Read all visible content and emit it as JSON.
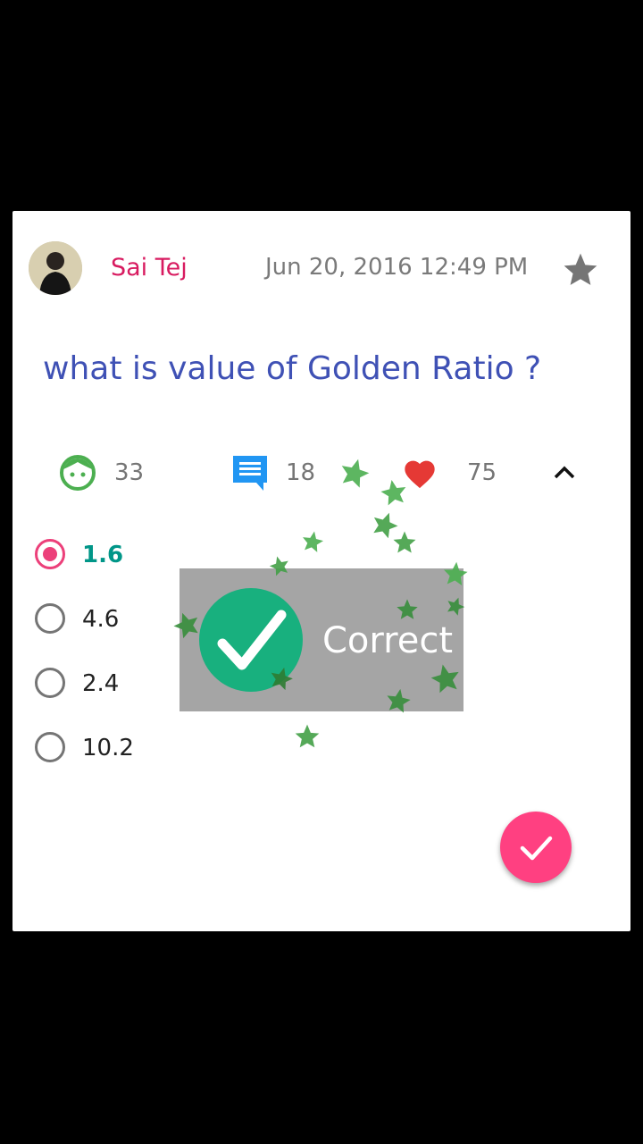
{
  "post": {
    "author": "Sai Tej",
    "datetime": "Jun 20, 2016 12:49 PM",
    "question": "what is value of Golden Ratio ?"
  },
  "stats": {
    "attempts": "33",
    "comments": "18",
    "likes": "75"
  },
  "options": [
    {
      "label": "1.6",
      "selected": true
    },
    {
      "label": "4.6",
      "selected": false
    },
    {
      "label": "2.4",
      "selected": false
    },
    {
      "label": "10.2",
      "selected": false
    }
  ],
  "toast": {
    "text": "Correct"
  },
  "colors": {
    "author": "#d81b60",
    "question": "#3f51b5",
    "selected_option": "#009688",
    "radio_selected": "#ec407a",
    "fab": "#ff4081",
    "check_badge": "#18b07e",
    "confetti_star": "#4caf50"
  },
  "icons": {
    "favorite": "star-icon",
    "attempts": "face-icon",
    "comments": "chat-icon",
    "likes": "heart-icon",
    "collapse": "chevron-up-icon",
    "submit": "check-icon"
  }
}
